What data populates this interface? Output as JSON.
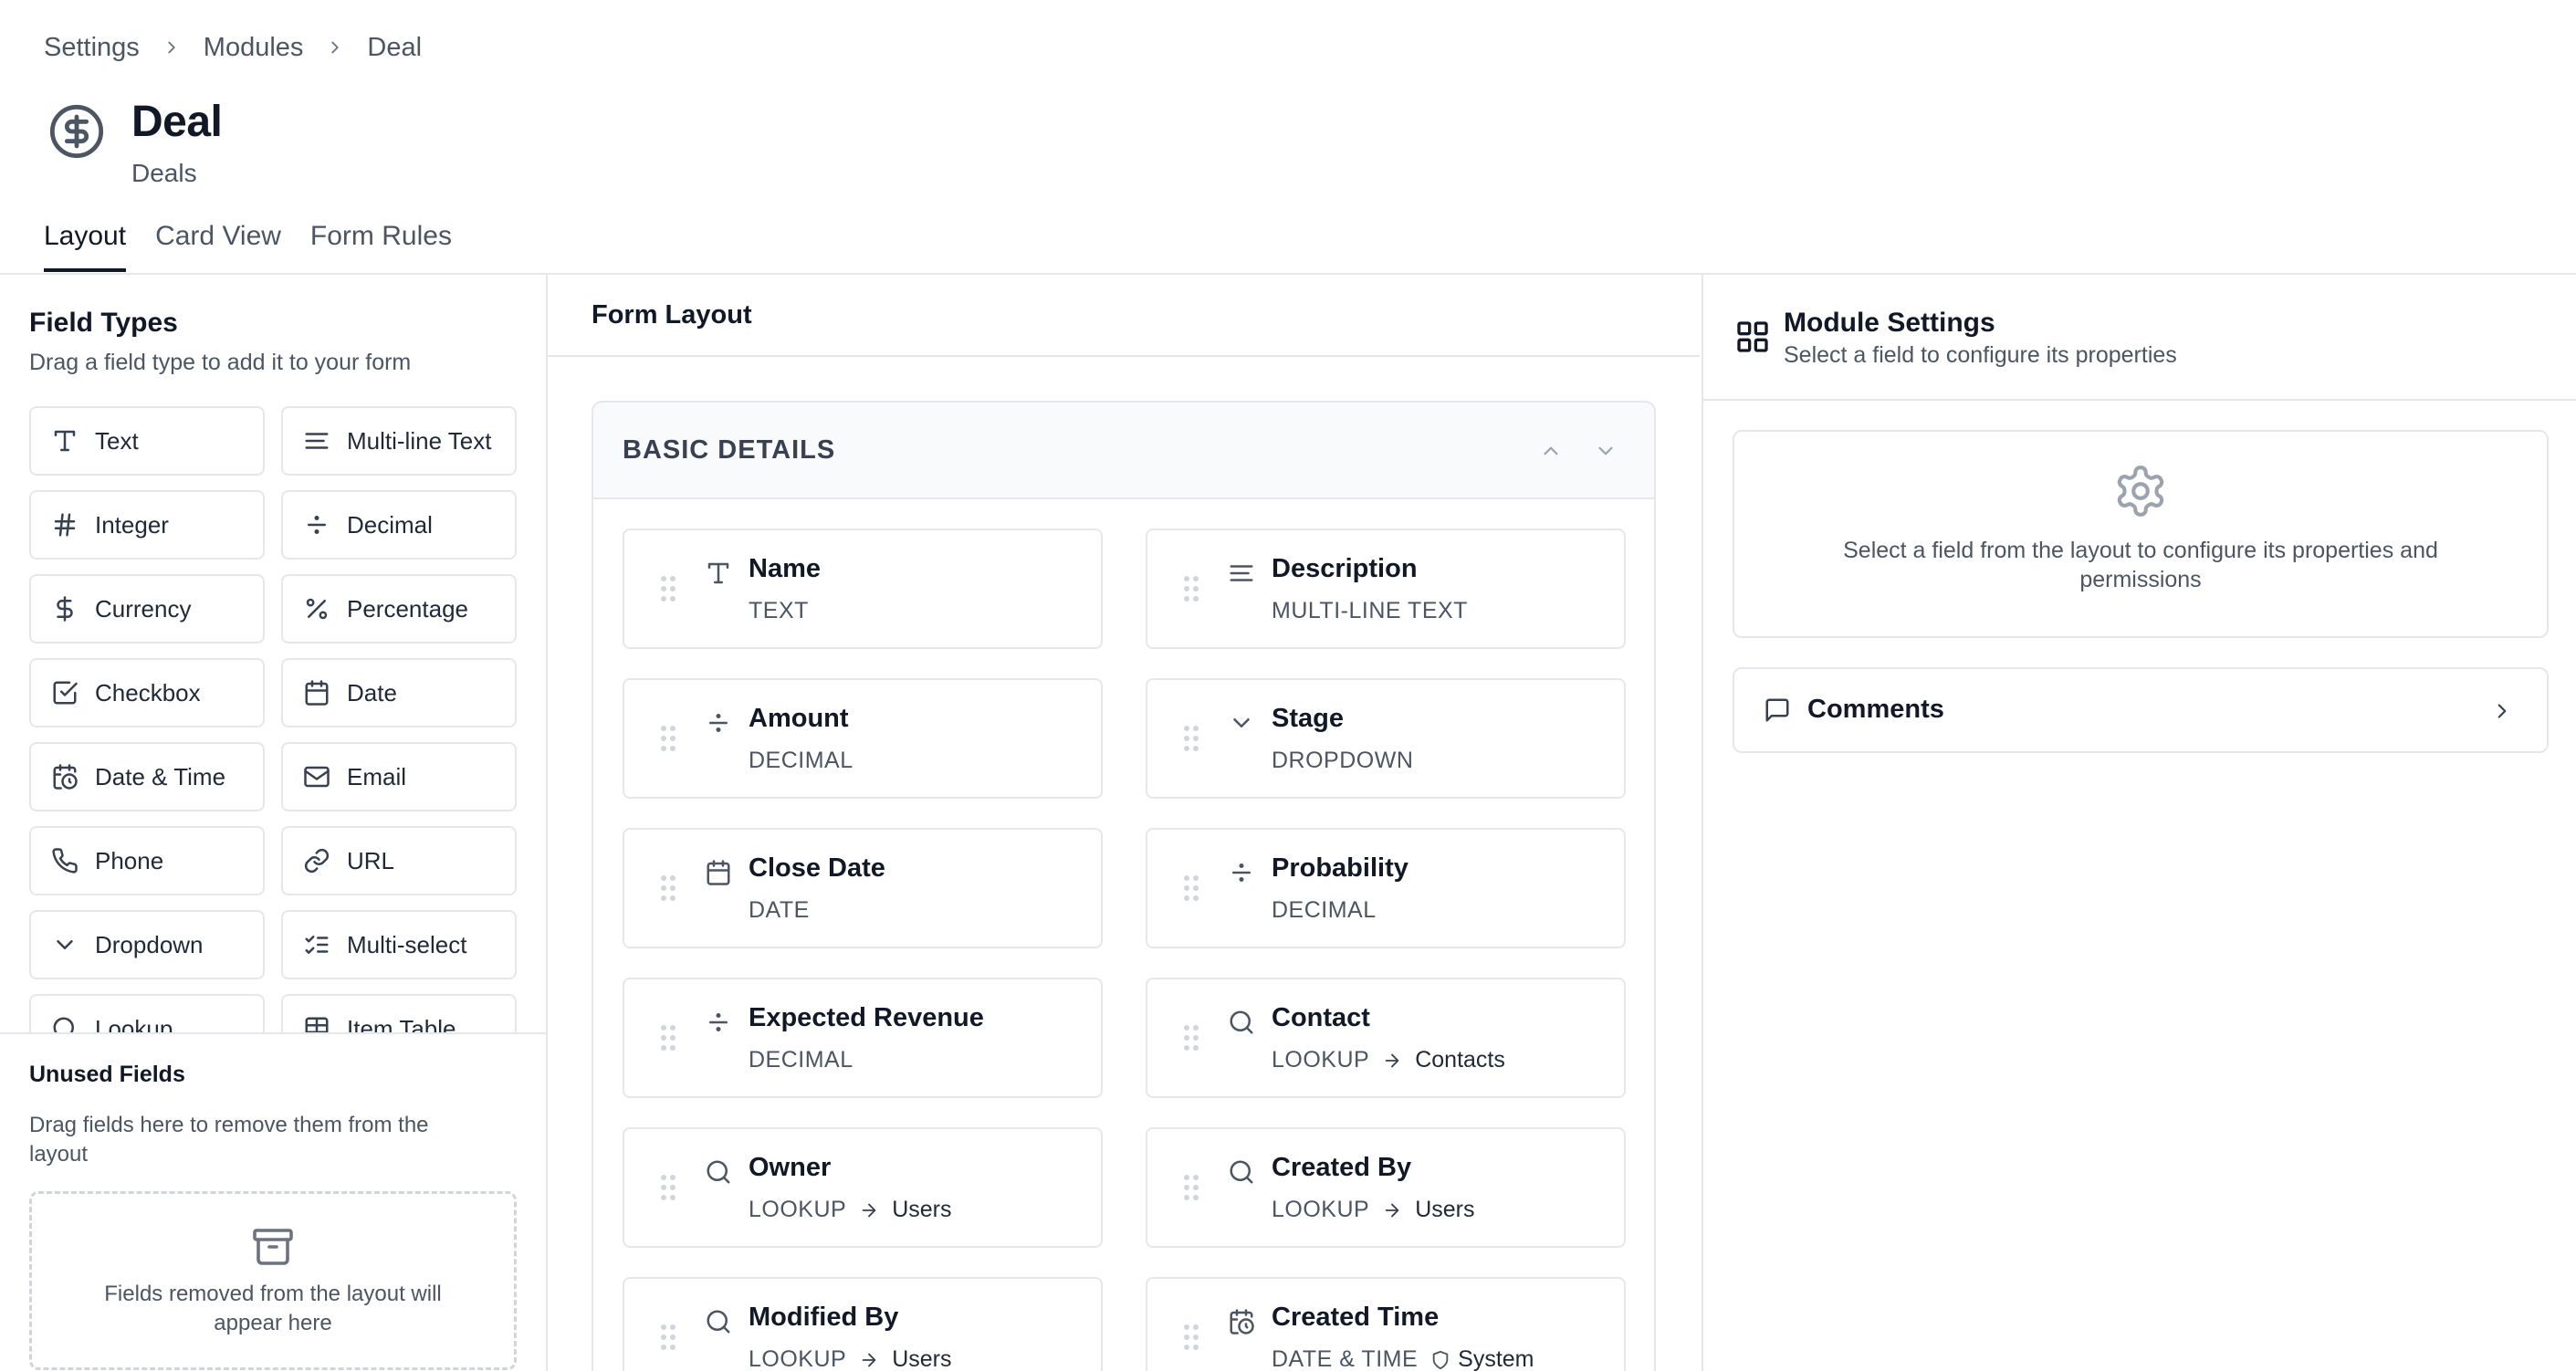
{
  "breadcrumb": {
    "items": [
      "Settings",
      "Modules",
      "Deal"
    ]
  },
  "header": {
    "title": "Deal",
    "subtitle": "Deals",
    "icon": "dollar-circle-icon"
  },
  "tabs": [
    {
      "label": "Layout",
      "active": true
    },
    {
      "label": "Card View",
      "active": false
    },
    {
      "label": "Form Rules",
      "active": false
    }
  ],
  "field_types": {
    "title": "Field Types",
    "description": "Drag a field type to add it to your form",
    "items": [
      {
        "label": "Text",
        "icon": "text-type-icon"
      },
      {
        "label": "Multi-line Text",
        "icon": "align-left-icon"
      },
      {
        "label": "Integer",
        "icon": "hash-icon"
      },
      {
        "label": "Decimal",
        "icon": "divide-icon"
      },
      {
        "label": "Currency",
        "icon": "dollar-icon"
      },
      {
        "label": "Percentage",
        "icon": "percent-icon"
      },
      {
        "label": "Checkbox",
        "icon": "checkbox-icon"
      },
      {
        "label": "Date",
        "icon": "calendar-icon"
      },
      {
        "label": "Date & Time",
        "icon": "calendar-clock-icon"
      },
      {
        "label": "Email",
        "icon": "mail-icon"
      },
      {
        "label": "Phone",
        "icon": "phone-icon"
      },
      {
        "label": "URL",
        "icon": "link-icon"
      },
      {
        "label": "Dropdown",
        "icon": "chevron-down-icon"
      },
      {
        "label": "Multi-select",
        "icon": "list-checks-icon"
      },
      {
        "label": "Lookup",
        "icon": "search-icon"
      },
      {
        "label": "Item Table",
        "icon": "table-icon"
      }
    ]
  },
  "unused_fields": {
    "title": "Unused Fields",
    "description": "Drag fields here to remove them from the layout",
    "empty_text": "Fields removed from the layout will appear here"
  },
  "form_layout": {
    "title": "Form Layout",
    "section": {
      "title": "BASIC DETAILS",
      "fields": [
        {
          "name": "Name",
          "type": "TEXT",
          "icon": "text-type-icon"
        },
        {
          "name": "Description",
          "type": "MULTI-LINE TEXT",
          "icon": "align-left-icon"
        },
        {
          "name": "Amount",
          "type": "DECIMAL",
          "icon": "divide-icon"
        },
        {
          "name": "Stage",
          "type": "DROPDOWN",
          "icon": "chevron-down-icon"
        },
        {
          "name": "Close Date",
          "type": "DATE",
          "icon": "calendar-icon"
        },
        {
          "name": "Probability",
          "type": "DECIMAL",
          "icon": "divide-icon"
        },
        {
          "name": "Expected Revenue",
          "type": "DECIMAL",
          "icon": "divide-icon"
        },
        {
          "name": "Contact",
          "type": "LOOKUP",
          "target": "Contacts",
          "icon": "search-icon"
        },
        {
          "name": "Owner",
          "type": "LOOKUP",
          "target": "Users",
          "icon": "search-icon"
        },
        {
          "name": "Created By",
          "type": "LOOKUP",
          "target": "Users",
          "icon": "search-icon"
        },
        {
          "name": "Modified By",
          "type": "LOOKUP",
          "target": "Users",
          "icon": "search-icon"
        },
        {
          "name": "Created Time",
          "type": "DATE & TIME",
          "badge": "System",
          "icon": "calendar-clock-icon"
        }
      ]
    }
  },
  "module_settings": {
    "title": "Module Settings",
    "description": "Select a field to configure its properties",
    "placeholder": "Select a field from the layout to configure its properties and permissions",
    "comments_label": "Comments"
  }
}
